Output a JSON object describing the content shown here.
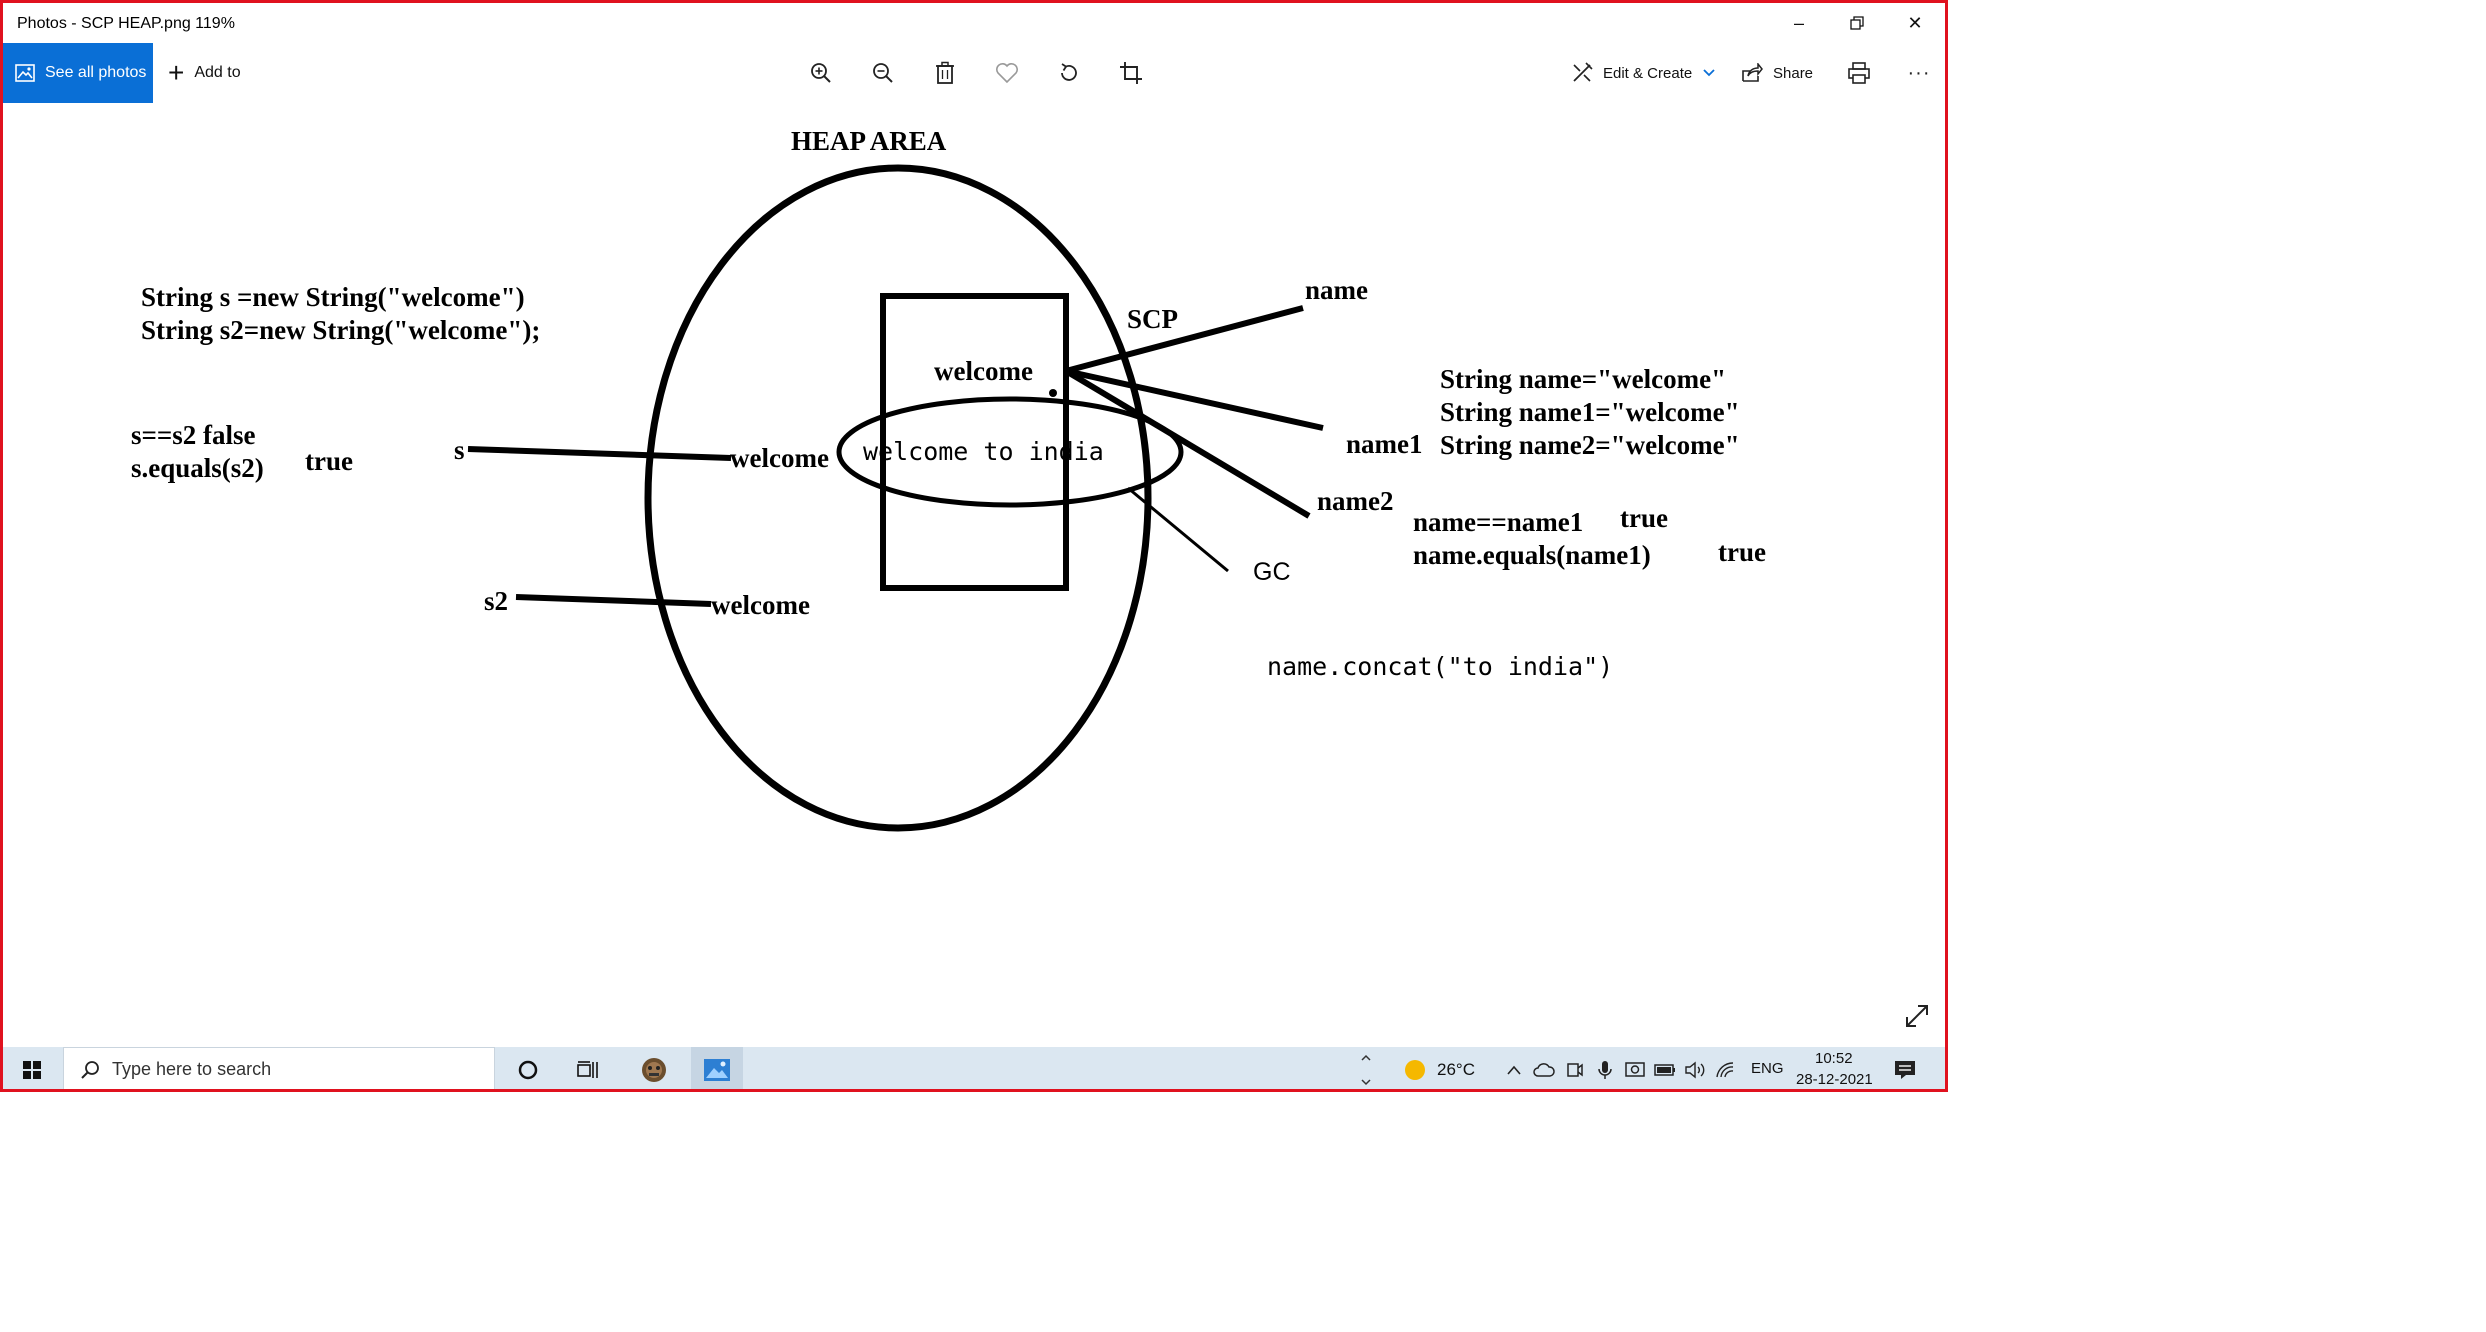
{
  "window": {
    "title": "Photos - SCP HEAP.png   119%",
    "minimize_glyph": "–",
    "restore_glyph": "❐",
    "close_glyph": "✕"
  },
  "toolbar": {
    "see_all_label": "See all photos",
    "add_to_label": "Add to",
    "edit_create_label": "Edit & Create",
    "share_label": "Share",
    "more_glyph": "···",
    "accent": "#0a6fd6"
  },
  "drawing": {
    "heap_title": "HEAP AREA",
    "code_line1": "String s =new String(\"welcome\")",
    "code_line2": "String s2=new String(\"welcome\");",
    "eq_line1": "s==s2  false",
    "eq_line2": "s.equals(s2)",
    "eq_true": "true",
    "ref_s": "s",
    "ref_s2": "s2",
    "obj_welcome_1": "welcome",
    "obj_welcome_2": "welcome",
    "scp_label": "SCP",
    "scp_welcome": "welcome",
    "welcome_to_india": "welcome to india",
    "ref_name": "name",
    "ref_name1": "name1",
    "ref_name2": "name2",
    "gc_label": "GC",
    "scp_code1": "String name=\"welcome\"",
    "scp_code2": "String name1=\"welcome\"",
    "scp_code3": "String name2=\"welcome\"",
    "name_eq": "name==name1",
    "name_eq_result": "true",
    "name_equals": "name.equals(name1)",
    "name_equals_result": "true",
    "concat_call": "name.concat(\"to india\")"
  },
  "taskbar": {
    "search_placeholder": "Type here to search",
    "weather_temp": "26°C",
    "language": "ENG",
    "time": "10:52",
    "date": "28-12-2021"
  },
  "colors": {
    "window_border": "#e0121f",
    "taskbar_bg": "#dbe7f1",
    "sun": "#f5b800"
  }
}
